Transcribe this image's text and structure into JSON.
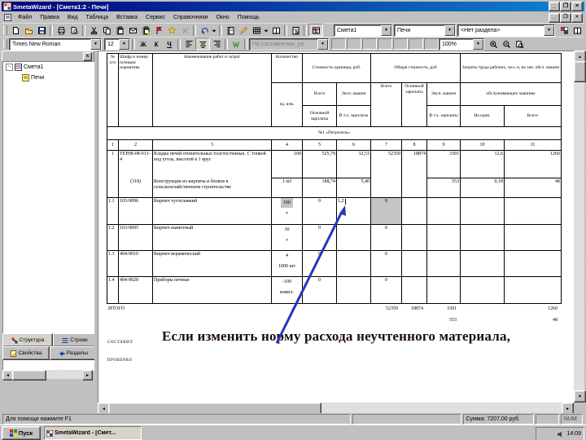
{
  "window": {
    "title": "SmetaWizard - [Смета1:2 - Печи]",
    "buttons": {
      "minimize": "_",
      "maximize": "❐",
      "close": "×"
    }
  },
  "menu": {
    "items": [
      "Файл",
      "Правка",
      "Вид",
      "Таблица",
      "Вставка",
      "Сервис",
      "Справочники",
      "Окно",
      "Помощь"
    ]
  },
  "toolbar1": {
    "items": [
      {
        "name": "new-document-icon",
        "icon": "page"
      },
      {
        "name": "open-icon",
        "icon": "folder"
      },
      {
        "name": "save-icon",
        "icon": "disk"
      },
      {
        "sep": true
      },
      {
        "name": "print-icon",
        "icon": "printer"
      },
      {
        "name": "print-preview-icon",
        "icon": "preview"
      },
      {
        "sep": true
      },
      {
        "name": "cut-icon",
        "icon": "scissors"
      },
      {
        "name": "copy-icon",
        "icon": "copy"
      },
      {
        "name": "paste-icon",
        "icon": "clipboard"
      },
      {
        "name": "mail-icon",
        "icon": "envelope"
      },
      {
        "name": "paste-special-icon",
        "icon": "clipboard2"
      },
      {
        "name": "flag-icon",
        "icon": "flag"
      },
      {
        "name": "wizard-icon",
        "icon": "star"
      },
      {
        "name": "delete-icon",
        "icon": "xgray",
        "disabled": true
      },
      {
        "sep": true
      },
      {
        "name": "undo-icon",
        "icon": "undo"
      },
      {
        "name": "undo-dropdown-icon",
        "icon": "drop",
        "drop": true
      },
      {
        "sep": true
      },
      {
        "name": "notebook-icon",
        "icon": "notebook"
      },
      {
        "name": "edit-pencil-icon",
        "icon": "pencil"
      },
      {
        "name": "grid-icon",
        "icon": "grid"
      },
      {
        "name": "grid-dropdown-icon",
        "icon": "drop",
        "drop": true
      },
      {
        "name": "book-icon",
        "icon": "book"
      },
      {
        "sep": true
      },
      {
        "name": "properties-icon",
        "icon": "props"
      },
      {
        "sep": true
      },
      {
        "name": "recalculate-icon",
        "icon": "recalc",
        "pressed": true
      }
    ],
    "combos": {
      "estimate": "Смета1",
      "document": "Печи",
      "section": "<Нет раздела>"
    },
    "right_items": [
      {
        "name": "resources-icon",
        "icon": "resources"
      },
      {
        "name": "directories-icon",
        "icon": "book"
      }
    ]
  },
  "toolbar2": {
    "font_name": "Times New Roman",
    "font_size": "12",
    "style_buttons": [
      {
        "name": "bold-button",
        "label": "Ж"
      },
      {
        "name": "italic-button",
        "label": "К"
      },
      {
        "name": "underline-button",
        "label": "Ч"
      }
    ],
    "align_buttons": [
      {
        "name": "align-left-icon",
        "icon": "alignL"
      },
      {
        "name": "align-center-icon",
        "icon": "alignC",
        "pressed": true
      },
      {
        "name": "align-right-icon",
        "icon": "alignR"
      }
    ],
    "check_button": {
      "name": "markup-check-icon",
      "icon": "wcheck"
    },
    "status_combo": "На составлении_ре",
    "blank_boxes": 7,
    "pattern_button": {
      "name": "pattern-icon",
      "icon": "pattern"
    },
    "zoom_value": "100%",
    "zoom_buttons": [
      {
        "name": "zoom-in-icon",
        "icon": "zoomin"
      },
      {
        "name": "zoom-out-icon",
        "icon": "zoomout"
      },
      {
        "name": "zoom-page-icon",
        "icon": "zoompage"
      }
    ]
  },
  "sidebar": {
    "close_label": "x",
    "tree": [
      {
        "label": "Смета1",
        "icon": "sheet-icon",
        "level": 0
      },
      {
        "label": "Печи",
        "icon": "note-icon",
        "level": 1
      }
    ],
    "tabs_row1": [
      {
        "label": "Структура",
        "icon": "structure",
        "active": true
      },
      {
        "label": "Строки",
        "icon": "rows",
        "active": false
      }
    ],
    "tabs_row2": [
      {
        "label": "Свойства",
        "icon": "props-tab",
        "active": false
      },
      {
        "label": "Разделы",
        "icon": "sections",
        "active": false
      }
    ]
  },
  "document": {
    "section_title": "№1 «Петрозель»",
    "column_numbers": [
      "1",
      "2",
      "3",
      "4",
      "5",
      "6",
      "7",
      "8",
      "9",
      "10",
      "11"
    ],
    "header_cells": [
      {
        "r": 0,
        "rs": 3,
        "c": 0,
        "t": "№ п/п",
        "al": "tc"
      },
      {
        "r": 0,
        "rs": 3,
        "c": 1,
        "t": "Шифр и номер позиции норматива",
        "al": "tl"
      },
      {
        "r": 0,
        "rs": 3,
        "c": 2,
        "t": "Наименование работ и затрат",
        "al": "tc"
      },
      {
        "r": 0,
        "c": 3,
        "t": "Количество",
        "al": "tc"
      },
      {
        "r": 1,
        "rs": 2,
        "c": 3,
        "t": "ед. изм.",
        "al": "cc"
      },
      {
        "r": 0,
        "c": 4,
        "cs": 2,
        "t": "Стоимость единицы, руб.",
        "al": "cc"
      },
      {
        "r": 0,
        "c": 6,
        "cs": 3,
        "t": "Общая стоимость, руб",
        "al": "cc"
      },
      {
        "r": 0,
        "c": 9,
        "cs": 2,
        "t": "Затраты труда рабочих, чел.-ч, не зан. обсл. машин",
        "al": "cc"
      },
      {
        "r": 1,
        "c": 4,
        "t": "Всего",
        "al": "cc"
      },
      {
        "r": 1,
        "c": 5,
        "t": "Эксп. машин",
        "al": "cc"
      },
      {
        "r": 1,
        "rs": 2,
        "c": 6,
        "t": "Всего",
        "al": "tc"
      },
      {
        "r": 1,
        "rs": 2,
        "c": 7,
        "t": "Основной зарплаты",
        "al": "tc"
      },
      {
        "r": 1,
        "c": 8,
        "t": "Эксп. машин",
        "al": "cc"
      },
      {
        "r": 1,
        "c": 9,
        "cs": 2,
        "t": "обслуживающих машины",
        "al": "cc"
      },
      {
        "r": 2,
        "c": 4,
        "t": "Основной зарплаты",
        "al": "cc"
      },
      {
        "r": 2,
        "c": 5,
        "t": "В т.ч. зарплаты",
        "al": "cc"
      },
      {
        "r": 2,
        "c": 8,
        "t": "В т.ч. зарплаты",
        "al": "cc"
      },
      {
        "r": 2,
        "c": 9,
        "t": "На един.",
        "al": "cc"
      },
      {
        "r": 2,
        "c": 10,
        "t": "Всего",
        "al": "cc"
      }
    ],
    "body_cells": [
      {
        "r": 5,
        "c": 0,
        "t": "1",
        "al": "tc",
        "nb": true
      },
      {
        "r": 5,
        "c": 1,
        "t": "ТЕР08-08-013-4",
        "al": "tl",
        "nb": true
      },
      {
        "r": 5,
        "c": 2,
        "t": "Кладка печей отопительных толстостенных. С топкой под уголь, высотой в 1 ярус",
        "al": "tl",
        "nb": true
      },
      {
        "r": 5,
        "c": 3,
        "t": "100",
        "al": "tr"
      },
      {
        "r": 5,
        "c": 4,
        "t": "525,79",
        "al": "tr"
      },
      {
        "r": 5,
        "c": 5,
        "t": "32,51",
        "al": "tr"
      },
      {
        "r": 5,
        "rs": 2,
        "c": 6,
        "t": "52359",
        "al": "tr"
      },
      {
        "r": 5,
        "rs": 2,
        "c": 7,
        "t": "18874",
        "al": "tr"
      },
      {
        "r": 5,
        "c": 8,
        "t": "3391",
        "al": "tr"
      },
      {
        "r": 5,
        "c": 9,
        "t": "12,6",
        "al": "tr"
      },
      {
        "r": 5,
        "c": 10,
        "t": "1260",
        "al": "tr"
      },
      {
        "r": 6,
        "c": 0,
        "t": "",
        "al": "tl"
      },
      {
        "r": 6,
        "c": 1,
        "t": "(318)",
        "al": "tc"
      },
      {
        "r": 6,
        "c": 2,
        "t": "Конструкции из кирпича и блоков в сельскохозяйственном строительстве",
        "al": "tl"
      },
      {
        "r": 6,
        "c": 3,
        "t": "1 м3",
        "al": "tc"
      },
      {
        "r": 6,
        "c": 4,
        "t": "188,74",
        "al": "tr"
      },
      {
        "r": 6,
        "c": 5,
        "t": "5,40",
        "al": "tr"
      },
      {
        "r": 6,
        "c": 8,
        "t": "553",
        "al": "tr"
      },
      {
        "r": 6,
        "c": 9,
        "t": "0,18",
        "al": "tr"
      },
      {
        "r": 6,
        "c": 10,
        "t": "48",
        "al": "tr"
      },
      {
        "r": 7,
        "c": 0,
        "t": "1.1",
        "al": "tl"
      },
      {
        "r": 7,
        "c": 1,
        "t": "103-9096",
        "al": "tl"
      },
      {
        "r": 7,
        "c": 2,
        "t": "Кирпич тугоплавкий",
        "al": "tl"
      },
      {
        "r": 7,
        "c": 3,
        "qty": "100",
        "unit": "т",
        "qty_hl": true
      },
      {
        "r": 7,
        "c": 4,
        "t": "0",
        "al": "tc"
      },
      {
        "r": 7,
        "c": 5,
        "edit": "1,2",
        "al": "tl"
      },
      {
        "r": 7,
        "c": 6,
        "t": "0",
        "al": "tc",
        "hl": true
      },
      {
        "r": 7,
        "c": 7,
        "t": "",
        "al": "tl"
      },
      {
        "r": 7,
        "c": 8,
        "t": "",
        "al": "tl"
      },
      {
        "r": 7,
        "c": 9,
        "t": "",
        "al": "tl"
      },
      {
        "r": 7,
        "c": 10,
        "t": "",
        "al": "tl"
      },
      {
        "r": 8,
        "c": 0,
        "t": "1.2",
        "al": "tl"
      },
      {
        "r": 8,
        "c": 1,
        "t": "103-9095",
        "al": "tl"
      },
      {
        "r": 8,
        "c": 2,
        "t": "Кирпич шамотный",
        "al": "tl"
      },
      {
        "r": 8,
        "c": 3,
        "qty": "30",
        "unit": "т"
      },
      {
        "r": 8,
        "c": 4,
        "t": "0",
        "al": "tc"
      },
      {
        "r": 8,
        "c": 5,
        "t": "",
        "al": "tl"
      },
      {
        "r": 8,
        "c": 6,
        "t": "0",
        "al": "tc"
      },
      {
        "r": 8,
        "c": 7,
        "t": "",
        "al": "tl"
      },
      {
        "r": 8,
        "c": 8,
        "t": "",
        "al": "tl"
      },
      {
        "r": 8,
        "c": 9,
        "t": "",
        "al": "tl"
      },
      {
        "r": 8,
        "c": 10,
        "t": "",
        "al": "tl"
      },
      {
        "r": 9,
        "c": 0,
        "t": "1.3",
        "al": "tl"
      },
      {
        "r": 9,
        "c": 1,
        "t": "404-9010",
        "al": "tl"
      },
      {
        "r": 9,
        "c": 2,
        "t": "Кирпич керамический",
        "al": "tl"
      },
      {
        "r": 9,
        "c": 3,
        "qty": "4",
        "unit": "1000 шт"
      },
      {
        "r": 9,
        "c": 4,
        "t": "0",
        "al": "tc"
      },
      {
        "r": 9,
        "c": 5,
        "t": "",
        "al": "tl"
      },
      {
        "r": 9,
        "c": 6,
        "t": "0",
        "al": "tc"
      },
      {
        "r": 9,
        "c": 7,
        "t": "",
        "al": "tl"
      },
      {
        "r": 9,
        "c": 8,
        "t": "",
        "al": "tl"
      },
      {
        "r": 9,
        "c": 9,
        "t": "",
        "al": "tl"
      },
      {
        "r": 9,
        "c": 10,
        "t": "",
        "al": "tl"
      },
      {
        "r": 10,
        "c": 0,
        "t": "1.4",
        "al": "tl"
      },
      {
        "r": 10,
        "c": 1,
        "t": "404-9020",
        "al": "tl"
      },
      {
        "r": 10,
        "c": 2,
        "t": "Приборы печные",
        "al": "tl"
      },
      {
        "r": 10,
        "c": 3,
        "qty": "-100",
        "unit": "компл."
      },
      {
        "r": 10,
        "c": 4,
        "t": "0",
        "al": "tc"
      },
      {
        "r": 10,
        "c": 5,
        "t": "",
        "al": "tl"
      },
      {
        "r": 10,
        "c": 6,
        "t": "0",
        "al": "tc"
      },
      {
        "r": 10,
        "c": 7,
        "t": "",
        "al": "tl"
      },
      {
        "r": 10,
        "c": 8,
        "t": "",
        "al": "tl"
      },
      {
        "r": 10,
        "c": 9,
        "t": "",
        "al": "tl"
      },
      {
        "r": 10,
        "c": 10,
        "t": "",
        "al": "tl"
      }
    ],
    "totals": {
      "label": "ИТОГО",
      "line1": [
        {
          "col": 7,
          "v": "52359"
        },
        {
          "col": 8,
          "v": "18874"
        },
        {
          "col": 9,
          "v": "3391"
        },
        {
          "col": 11,
          "v": "1260"
        }
      ],
      "line2": [
        {
          "col": 9,
          "v": "553"
        },
        {
          "col": 11,
          "v": "48"
        }
      ]
    },
    "footer": {
      "composed": "СОСТАВИЛ",
      "checked": "ПРОВЕРИЛ"
    },
    "caption": "Если изменить норму расхода неучтенного материала,"
  },
  "statusbar": {
    "help": "Для помощи нажмите F1",
    "sum": "Сумма: 7207,00 руб.",
    "num": "NUM"
  },
  "taskbar": {
    "start": "Пуск",
    "task": "SmetaWizard - [Смет...",
    "time": "14:09"
  }
}
